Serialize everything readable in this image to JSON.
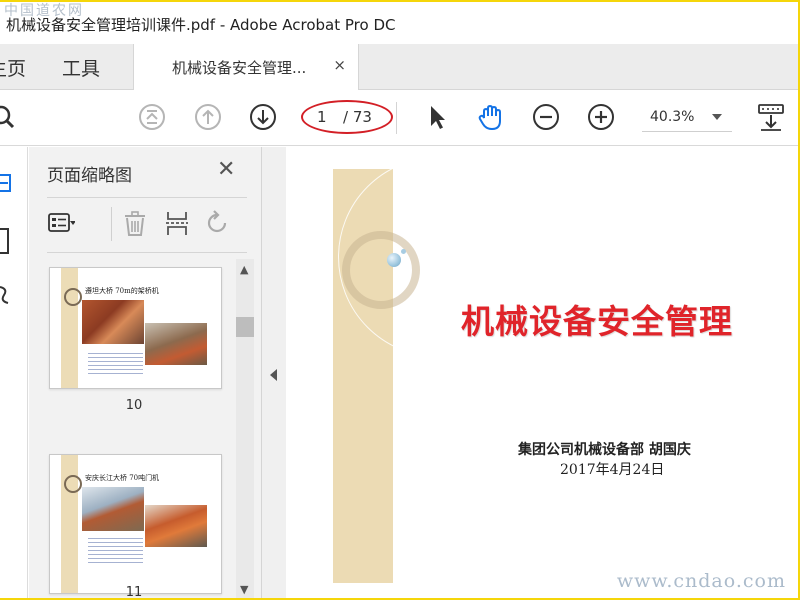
{
  "watermarks": {
    "top": "中国道农网",
    "bottom": "www.cndao.com"
  },
  "window": {
    "title": "机械设备安全管理培训课件.pdf - Adobe Acrobat Pro DC"
  },
  "tabs": {
    "home": "主页",
    "tools": "工具",
    "document": "机械设备安全管理...",
    "close_glyph": "×"
  },
  "toolbar": {
    "current_page": "1",
    "total_pages": "/ 73",
    "zoom": "40.3%",
    "icons": [
      "search-icon",
      "first-page-icon",
      "prev-page-icon",
      "next-page-icon",
      "select-pointer-icon",
      "hand-tool-icon",
      "zoom-out-icon",
      "zoom-in-icon",
      "page-layout-icon"
    ]
  },
  "thumbnails_panel": {
    "title": "页面缩略图",
    "close_glyph": "✕",
    "scroll_up": "▲",
    "scroll_down": "▼",
    "pages": [
      {
        "number": "10",
        "heading": "遵坦大桥 70m的架桥机"
      },
      {
        "number": "11",
        "heading": "安庆长江大桥 70吨门机"
      }
    ]
  },
  "slide": {
    "title": "机械设备安全管理",
    "author": "集团公司机械设备部  胡国庆",
    "date": "2017年4月24日"
  },
  "colors": {
    "accent_blue": "#1473e6",
    "title_red": "#e0242a",
    "annotation_red": "#d31f26",
    "frame_yellow": "#f5d60a"
  }
}
